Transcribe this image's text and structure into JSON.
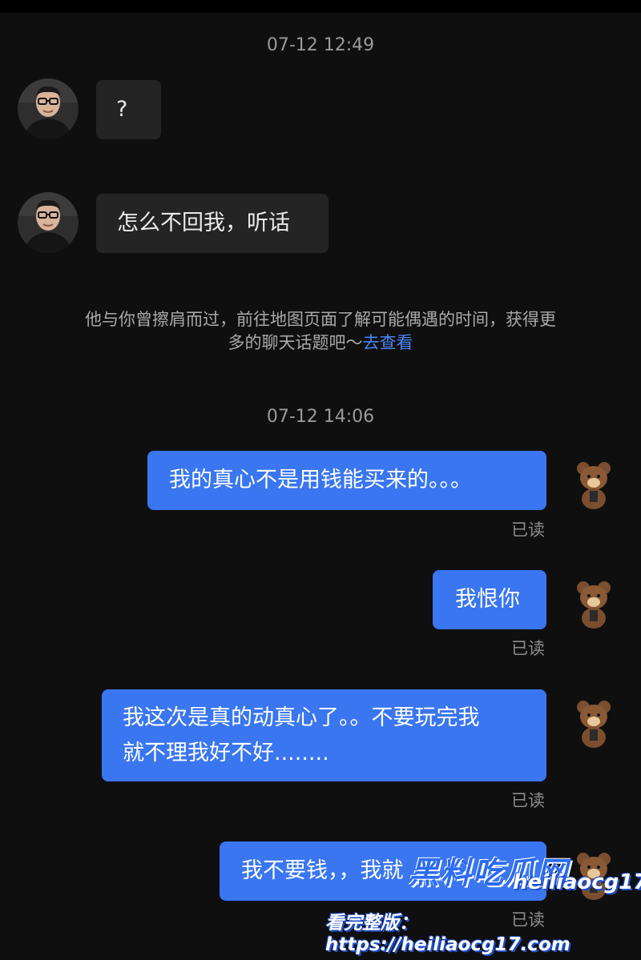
{
  "chat": {
    "groups": [
      {
        "timestamp": "07-12 12:49"
      },
      {
        "timestamp": "07-12 14:06"
      }
    ],
    "incoming": [
      {
        "text": "?",
        "avatar": "man-with-glasses-avatar"
      },
      {
        "text": "怎么不回我，听话",
        "avatar": "man-with-glasses-avatar"
      }
    ],
    "notice": {
      "text": "他与你曾擦肩而过，前往地图页面了解可能偶遇的时间，获得更多的聊天话题吧～",
      "link": "去查看"
    },
    "outgoing": [
      {
        "text": "我的真心不是用钱能买来的。。。",
        "status": "已读",
        "avatar": "bear-avatar"
      },
      {
        "text": "我恨你",
        "status": "已读",
        "avatar": "bear-avatar"
      },
      {
        "line1": "我这次是真的动真心了。。不要玩完我",
        "line2": "就不理我好不好........",
        "status": "已读",
        "avatar": "bear-avatar"
      },
      {
        "text": "我不要钱，，我就",
        "status": "已读",
        "avatar": "bear-avatar"
      }
    ]
  },
  "watermark": {
    "title": "黑料吃瓜网",
    "url": "heiliaocg17.com",
    "line": "看完整版：https://heiliaocg17.com"
  },
  "colors": {
    "background": "#0f0f0f",
    "incoming_bubble": "#242424",
    "outgoing_bubble": "#3a76f0",
    "link": "#4a86f5"
  }
}
